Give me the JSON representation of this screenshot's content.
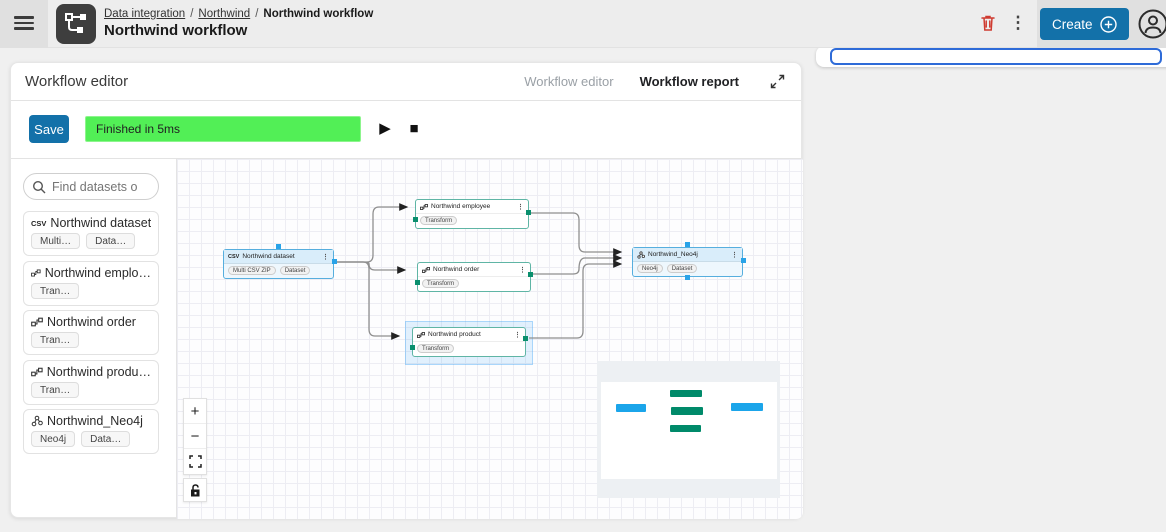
{
  "header": {
    "breadcrumb": [
      "Data integration",
      "Northwind",
      "Northwind workflow"
    ],
    "separator": "/",
    "title": "Northwind workflow",
    "create_label": "Create"
  },
  "right_panel": {
    "focused_input_value": ""
  },
  "panel": {
    "title": "Workflow editor",
    "tabs": [
      {
        "label": "Workflow editor",
        "active": false
      },
      {
        "label": "Workflow report",
        "active": true
      }
    ]
  },
  "toolbar": {
    "save_label": "Save",
    "status_text": "Finished in 5ms"
  },
  "icons": {
    "kebab": "⋮",
    "play": "▶",
    "stop": "■",
    "plus": "+",
    "minus": "−"
  },
  "sidebar": {
    "search_placeholder": "Find datasets o",
    "items": [
      {
        "icon": "csv",
        "icon_text": "CSV",
        "name": "Northwind dataset",
        "chips": [
          "Multi…",
          "Data…"
        ]
      },
      {
        "icon": "workflow",
        "name": "Northwind emplo…",
        "chips": [
          "Tran…"
        ]
      },
      {
        "icon": "workflow",
        "name": "Northwind order",
        "chips": [
          "Tran…"
        ]
      },
      {
        "icon": "workflow",
        "name": "Northwind produ…",
        "chips": [
          "Tran…"
        ]
      },
      {
        "icon": "neo4j",
        "name": "Northwind_Neo4j",
        "chips": [
          "Neo4j",
          "Data…"
        ]
      }
    ]
  },
  "canvas": {
    "nodes": [
      {
        "icon": "csv",
        "icon_text": "CSV",
        "name": "Northwind dataset",
        "chips": [
          "Multi CSV ZIP",
          "Dataset"
        ],
        "color": "blue"
      },
      {
        "icon": "workflow",
        "name": "Northwind employee",
        "chips": [
          "Transform"
        ],
        "color": "teal"
      },
      {
        "icon": "workflow",
        "name": "Northwind order",
        "chips": [
          "Transform"
        ],
        "color": "teal"
      },
      {
        "icon": "workflow",
        "name": "Northwind product",
        "chips": [
          "Transform"
        ],
        "color": "teal"
      },
      {
        "icon": "neo4j",
        "name": "Northwind_Neo4j",
        "chips": [
          "Neo4j",
          "Dataset"
        ],
        "color": "blue"
      }
    ]
  },
  "colors": {
    "accent_blue": "#1371a9",
    "status_green": "#52ef56",
    "node_blue_border": "#56aede",
    "node_teal_border": "#5fb5a5",
    "minimap_blue": "#1ba5ea",
    "minimap_teal": "#008a6a",
    "trash_red": "#cf3b30",
    "focus_blue": "#2e6bd8"
  }
}
